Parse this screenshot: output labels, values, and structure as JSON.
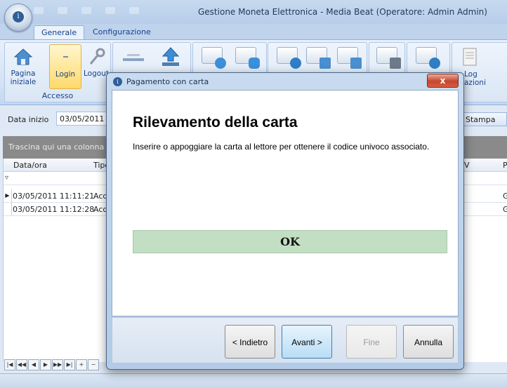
{
  "window": {
    "title": "Gestione Moneta Elettronica - Media Beat (Operatore: Admin Admin)"
  },
  "ribbon": {
    "tabs": [
      {
        "label": "Generale"
      },
      {
        "label": "Configurazione"
      }
    ],
    "group_accesso": {
      "label": "Accesso",
      "buttons": [
        {
          "label": "Pagina iniziale",
          "icon": "home-icon"
        },
        {
          "label": "Login",
          "icon": "login-icon"
        },
        {
          "label": "Logout",
          "icon": "key-icon"
        }
      ]
    },
    "log_label": "Log\nazioni"
  },
  "filter": {
    "date_label": "Data inizio",
    "date_value": "03/05/2011",
    "stampa_label": "Stampa"
  },
  "grid": {
    "group_hint": "Trascina qui una colonna per",
    "columns": [
      "Data/ora",
      "Tipo",
      "V",
      "P"
    ],
    "rows": [
      {
        "datetime": "03/05/2011 11:11:21",
        "tipo": "Acq",
        "end": "G"
      },
      {
        "datetime": "03/05/2011 11:12:28",
        "tipo": "Acq",
        "end": "G"
      }
    ]
  },
  "dialog": {
    "title": "Pagamento con carta",
    "heading": "Rilevamento della carta",
    "text": "Inserire o appoggiare la carta al lettore per ottenere il codice univoco associato.",
    "ok_label": "OK",
    "buttons": {
      "back": "< Indietro",
      "next": "Avanti >",
      "finish": "Fine",
      "cancel": "Annulla"
    },
    "close_glyph": "x"
  },
  "colors": {
    "ok_bar": "#c2dfc3",
    "close": "#c7452c",
    "ribbon_text": "#15428b"
  }
}
